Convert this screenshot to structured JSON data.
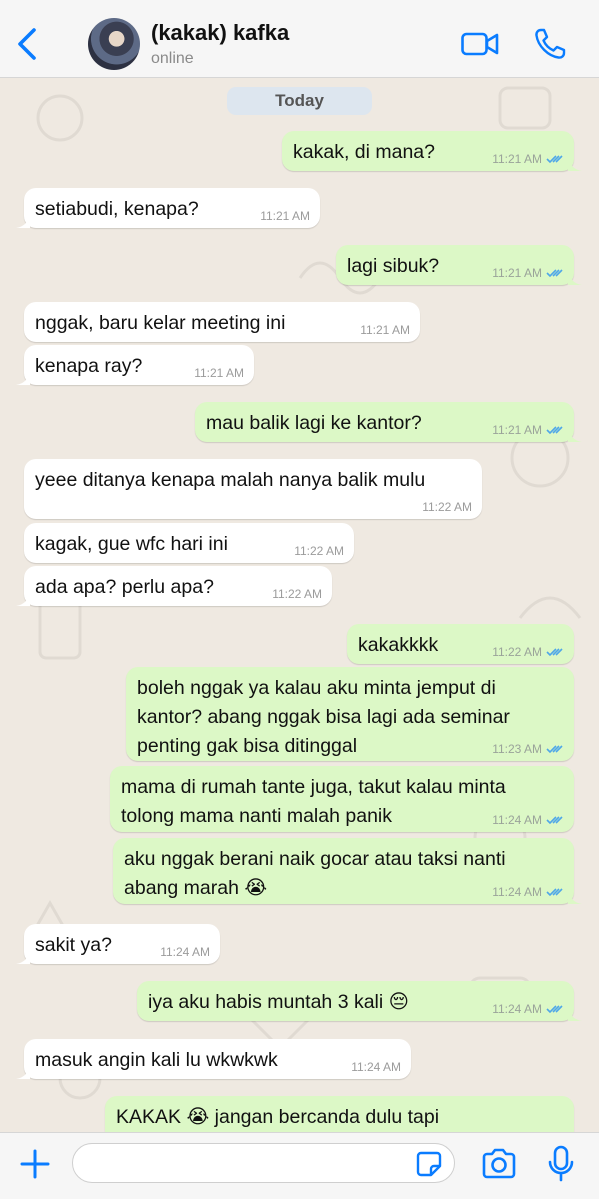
{
  "header": {
    "contact_name": "(kakak) kafka",
    "status": "online"
  },
  "chat": {
    "date_label": "Today",
    "messages": [
      {
        "dir": "out",
        "text": "kakak, di mana?",
        "time": "11:21 AM"
      },
      {
        "dir": "in",
        "text": "setiabudi, kenapa?",
        "time": "11:21 AM"
      },
      {
        "dir": "out",
        "text": "lagi sibuk?",
        "time": "11:21 AM"
      },
      {
        "dir": "in",
        "text": "nggak, baru kelar meeting ini",
        "time": "11:21 AM"
      },
      {
        "dir": "in",
        "text": "kenapa ray?",
        "time": "11:21 AM"
      },
      {
        "dir": "out",
        "text": "mau balik lagi ke kantor?",
        "time": "11:21 AM"
      },
      {
        "dir": "in",
        "text": "yeee ditanya kenapa malah nanya balik mulu",
        "time": "11:22 AM"
      },
      {
        "dir": "in",
        "text": "kagak, gue wfc hari ini",
        "time": "11:22 AM"
      },
      {
        "dir": "in",
        "text": "ada apa? perlu apa?",
        "time": "11:22 AM"
      },
      {
        "dir": "out",
        "text": "kakakkkk",
        "time": "11:22 AM"
      },
      {
        "dir": "out",
        "lines": [
          "boleh nggak ya kalau aku minta jemput di",
          "kantor? abang nggak bisa lagi ada seminar",
          "penting gak bisa ditinggal"
        ],
        "time": "11:23 AM"
      },
      {
        "dir": "out",
        "lines": [
          "mama di rumah tante juga, takut kalau minta",
          "tolong mama nanti malah panik"
        ],
        "time": "11:24 AM"
      },
      {
        "dir": "out",
        "lines": [
          "aku nggak berani naik gocar atau taksi nanti",
          "abang marah 😭"
        ],
        "time": "11:24 AM"
      },
      {
        "dir": "in",
        "text": "sakit ya?",
        "time": "11:24 AM"
      },
      {
        "dir": "out",
        "text": "iya aku habis muntah 3 kali 😔",
        "time": "11:24 AM"
      },
      {
        "dir": "in",
        "text": "masuk angin kali lu wkwkwk",
        "time": "11:24 AM"
      },
      {
        "dir": "out",
        "text": "KAKAK 😭 jangan bercanda dulu tapi",
        "time": ""
      }
    ]
  },
  "composer": {
    "value": ""
  },
  "colors": {
    "accent": "#0a7cff",
    "outgoing_bubble": "#dcf8c6",
    "incoming_bubble": "#ffffff",
    "read_ticks": "#4fa7e8",
    "chat_background": "#efe9e1"
  },
  "icons": {
    "back": "chevron-left-icon",
    "video": "video-camera-icon",
    "phone": "phone-icon",
    "plus": "plus-icon",
    "sticker": "sticker-icon",
    "camera": "camera-icon",
    "mic": "microphone-icon"
  }
}
